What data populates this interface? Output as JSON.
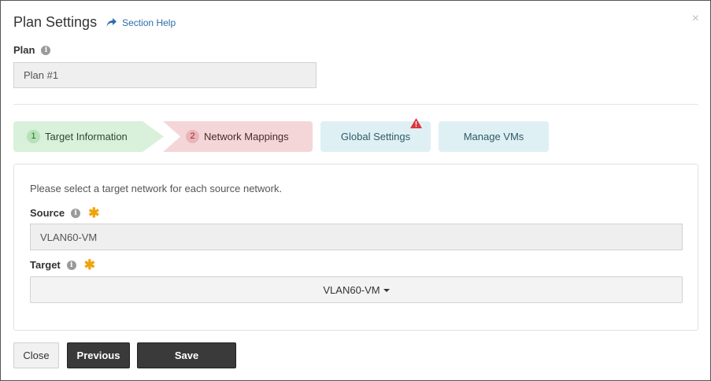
{
  "dialog": {
    "title": "Plan Settings",
    "help_link": "Section Help",
    "close_glyph": "×"
  },
  "plan": {
    "label": "Plan",
    "value": "Plan #1"
  },
  "wizard": {
    "steps": [
      {
        "number": "1",
        "label": "Target Information",
        "state": "complete"
      },
      {
        "number": "2",
        "label": "Network Mappings",
        "state": "active"
      },
      {
        "number": "",
        "label": "Global Settings",
        "state": "warning"
      },
      {
        "number": "",
        "label": "Manage VMs",
        "state": "pending"
      }
    ]
  },
  "panel": {
    "instruction": "Please select a target network for each source network.",
    "source": {
      "label": "Source",
      "value": "VLAN60-VM"
    },
    "target": {
      "label": "Target",
      "selected": "VLAN60-VM"
    }
  },
  "footer": {
    "close_label": "Close",
    "previous_label": "Previous",
    "save_label": "Save"
  },
  "colors": {
    "step_complete": "#d9f0da",
    "step_active": "#f5d6d8",
    "step_pending": "#dff0f5",
    "required": "#f0a30a",
    "warning": "#d9363e",
    "link": "#2b6ea8",
    "primary_button": "#3a3a3a"
  },
  "icons": {
    "help": "share-arrow-icon",
    "info": "info-icon",
    "required": "asterisk-icon",
    "warning": "warning-triangle-icon",
    "close": "close-icon",
    "dropdown": "caret-down-icon"
  }
}
